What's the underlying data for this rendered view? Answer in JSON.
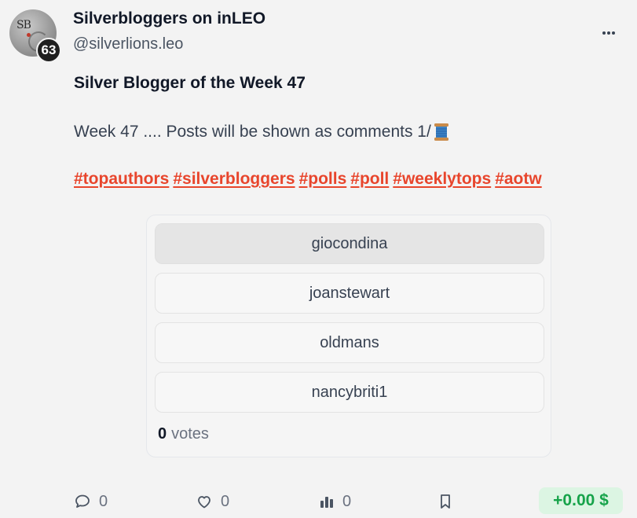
{
  "author": {
    "display_name": "Silverbloggers on inLEO",
    "handle": "@silverlions.leo",
    "reputation": "63",
    "avatar_monogram": "SB"
  },
  "post": {
    "title": "Silver Blogger of the Week 47",
    "body": "Week 47 .... Posts will be shown as comments 1/",
    "body_emoji": "spool-of-thread-icon",
    "hashtags": [
      "#topauthors",
      "#silverbloggers",
      "#polls",
      "#poll",
      "#weeklytops",
      "#aotw"
    ]
  },
  "poll": {
    "options": [
      {
        "label": "giocondina",
        "highlighted": true
      },
      {
        "label": "joanstewart",
        "highlighted": false
      },
      {
        "label": "oldmans",
        "highlighted": false
      },
      {
        "label": "nancybriti1",
        "highlighted": false
      }
    ],
    "vote_count": "0",
    "votes_label": "votes"
  },
  "actions": {
    "comments": "0",
    "likes": "0",
    "stats": "0",
    "payout": "+0.00 $"
  },
  "colors": {
    "hashtag": "#e8452c",
    "payout_text": "#16a34a",
    "payout_bg": "#dcf5e3",
    "background": "#f3f3f3"
  }
}
